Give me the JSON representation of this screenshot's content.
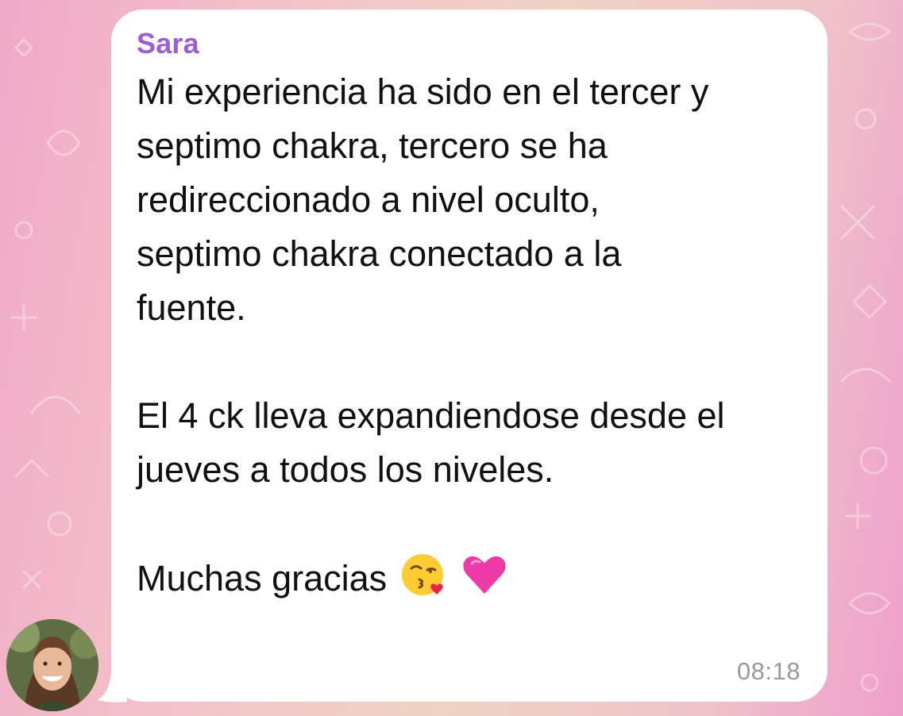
{
  "chat": {
    "sender_name": "Sara",
    "sender_color": "#9a5fd6",
    "message_lines": [
      "Mi experiencia ha sido en el tercer y",
      "septimo chakra, tercero se ha",
      "redireccionado a nivel oculto,",
      "septimo chakra conectado a la",
      "fuente."
    ],
    "message_lines_2": [
      "El 4 ck lleva expandiendose desde el",
      "jueves a todos los niveles."
    ],
    "closing_text": "Muchas gracias",
    "emojis": [
      "kissing-face-with-heart-emoji",
      "pink-heart-emoji"
    ],
    "timestamp": "08:18",
    "bubble_color": "#ffffff",
    "background_colors": [
      "#f0a9c8",
      "#f0d3c4",
      "#ee9fcb"
    ]
  }
}
